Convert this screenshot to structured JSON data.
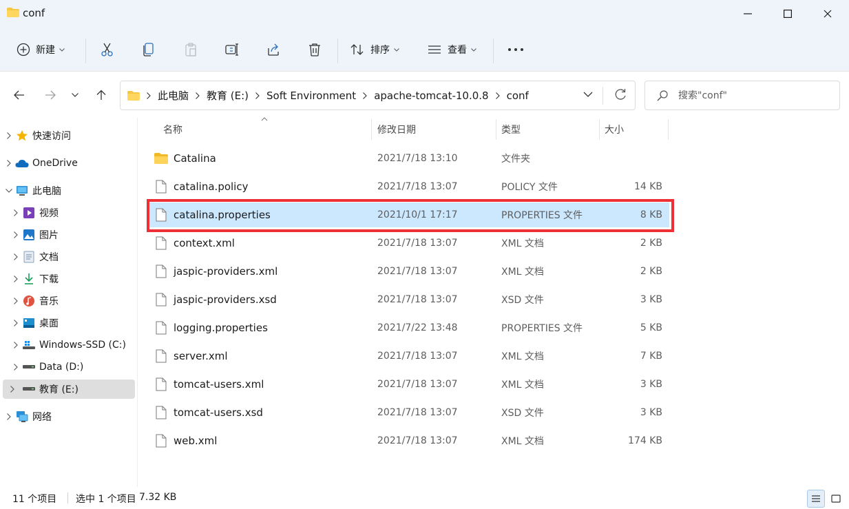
{
  "window": {
    "title": "conf"
  },
  "toolbar": {
    "new_label": "新建",
    "sort_label": "排序",
    "view_label": "查看"
  },
  "address": {
    "crumbs": [
      "此电脑",
      "教育 (E:)",
      "Soft Environment",
      "apache-tomcat-10.0.8",
      "conf"
    ],
    "search_placeholder": "搜索\"conf\""
  },
  "nav": {
    "items": [
      {
        "label": "快速访问",
        "icon": "star-icon"
      },
      {
        "label": "OneDrive",
        "icon": "cloud-icon"
      },
      {
        "label": "此电脑",
        "icon": "computer-icon"
      },
      {
        "label": "视频",
        "icon": "video-icon"
      },
      {
        "label": "图片",
        "icon": "pictures-icon"
      },
      {
        "label": "文档",
        "icon": "documents-icon"
      },
      {
        "label": "下载",
        "icon": "download-icon"
      },
      {
        "label": "音乐",
        "icon": "music-icon"
      },
      {
        "label": "桌面",
        "icon": "desktop-icon"
      },
      {
        "label": "Windows-SSD (C:)",
        "icon": "windows-drive-icon"
      },
      {
        "label": "Data (D:)",
        "icon": "drive-icon"
      },
      {
        "label": "教育 (E:)",
        "icon": "drive-icon"
      },
      {
        "label": "网络",
        "icon": "network-icon"
      }
    ]
  },
  "columns": {
    "name": "名称",
    "date": "修改日期",
    "type": "类型",
    "size": "大小"
  },
  "files": [
    {
      "name": "Catalina",
      "date": "2021/7/18 13:10",
      "type": "文件夹",
      "size": ""
    },
    {
      "name": "catalina.policy",
      "date": "2021/7/18 13:07",
      "type": "POLICY 文件",
      "size": "14 KB"
    },
    {
      "name": "catalina.properties",
      "date": "2021/10/1 17:17",
      "type": "PROPERTIES 文件",
      "size": "8 KB"
    },
    {
      "name": "context.xml",
      "date": "2021/7/18 13:07",
      "type": "XML 文档",
      "size": "2 KB"
    },
    {
      "name": "jaspic-providers.xml",
      "date": "2021/7/18 13:07",
      "type": "XML 文档",
      "size": "2 KB"
    },
    {
      "name": "jaspic-providers.xsd",
      "date": "2021/7/18 13:07",
      "type": "XSD 文件",
      "size": "3 KB"
    },
    {
      "name": "logging.properties",
      "date": "2021/7/22 13:48",
      "type": "PROPERTIES 文件",
      "size": "5 KB"
    },
    {
      "name": "server.xml",
      "date": "2021/7/18 13:07",
      "type": "XML 文档",
      "size": "7 KB"
    },
    {
      "name": "tomcat-users.xml",
      "date": "2021/7/18 13:07",
      "type": "XML 文档",
      "size": "3 KB"
    },
    {
      "name": "tomcat-users.xsd",
      "date": "2021/7/18 13:07",
      "type": "XSD 文件",
      "size": "3 KB"
    },
    {
      "name": "web.xml",
      "date": "2021/7/18 13:07",
      "type": "XML 文档",
      "size": "174 KB"
    }
  ],
  "status": {
    "count": "11 个项目",
    "selected": "选中 1 个项目",
    "selected_size": "7.32 KB"
  },
  "colors": {
    "selection": "#cce8ff",
    "highlight_box": "#ee3036",
    "folder": "#f6c744"
  }
}
